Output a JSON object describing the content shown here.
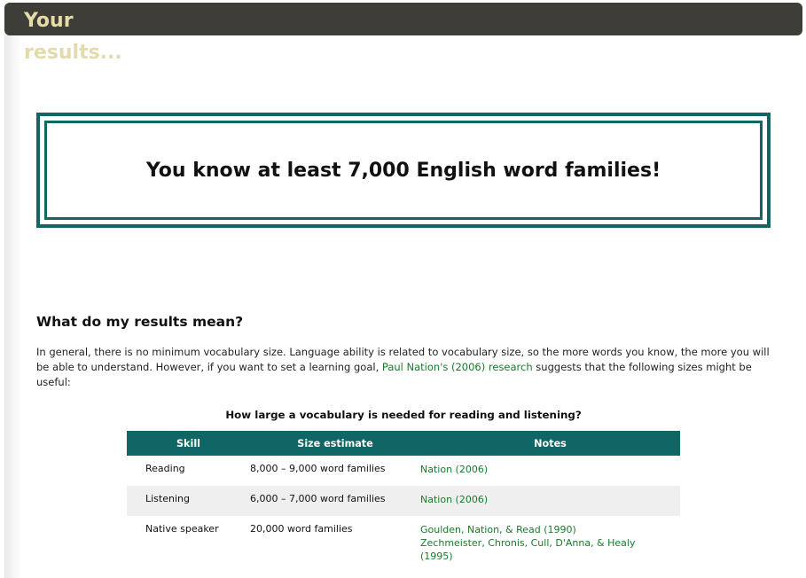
{
  "header": {
    "title_line1": "Your",
    "title_line2": "results..."
  },
  "result": {
    "message": "You know at least 7,000 English word families!"
  },
  "section": {
    "heading": "What do my results mean?",
    "intro_before": "In general, there is no minimum vocabulary size. Language ability is related to vocabulary size, so the more words you know, the more you will be able to understand. However, if you want to set a learning goal, ",
    "intro_link": "Paul Nation's (2006) research",
    "intro_after": " suggests that the following sizes might be useful:"
  },
  "table": {
    "caption": "How large a vocabulary is needed for reading and listening?",
    "headers": {
      "skill": "Skill",
      "size": "Size estimate",
      "notes": "Notes"
    },
    "rows": [
      {
        "skill": "Reading",
        "size": "8,000 – 9,000 word families",
        "notes": [
          "Nation (2006)"
        ]
      },
      {
        "skill": "Listening",
        "size": "6,000 – 7,000 word families",
        "notes": [
          "Nation (2006)"
        ]
      },
      {
        "skill": "Native speaker",
        "size": "20,000 word families",
        "notes": [
          "Goulden, Nation, & Read (1990)",
          "Zechmeister, Chronis, Cull, D'Anna, & Healy",
          "(1995)"
        ]
      }
    ]
  },
  "colors": {
    "title_bar": "#3f3d37",
    "title_text": "#e6dcaa",
    "accent": "#0f6664",
    "link": "#1a7a2a",
    "row_alt": "#efefef"
  }
}
